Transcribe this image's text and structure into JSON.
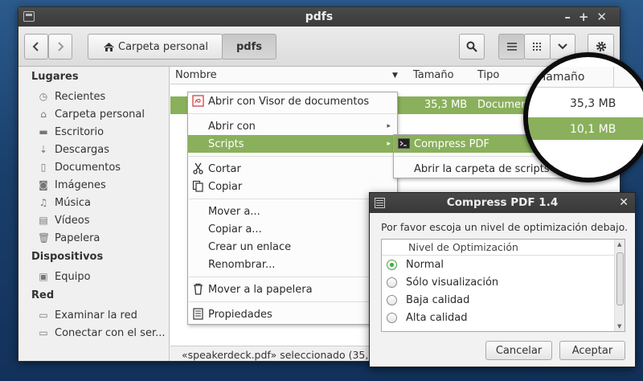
{
  "window": {
    "title": "pdfs"
  },
  "toolbar": {
    "path": [
      "Carpeta personal",
      "pdfs"
    ]
  },
  "sidebar": {
    "sections": [
      {
        "title": "Lugares",
        "items": [
          {
            "label": "Recientes",
            "icon": "clock-icon"
          },
          {
            "label": "Carpeta personal",
            "icon": "home-icon"
          },
          {
            "label": "Escritorio",
            "icon": "desktop-icon"
          },
          {
            "label": "Descargas",
            "icon": "download-icon"
          },
          {
            "label": "Documentos",
            "icon": "document-icon"
          },
          {
            "label": "Imágenes",
            "icon": "camera-icon"
          },
          {
            "label": "Música",
            "icon": "music-icon"
          },
          {
            "label": "Vídeos",
            "icon": "film-icon"
          },
          {
            "label": "Papelera",
            "icon": "trash-icon"
          }
        ]
      },
      {
        "title": "Dispositivos",
        "items": [
          {
            "label": "Equipo",
            "icon": "drive-icon"
          }
        ]
      },
      {
        "title": "Red",
        "items": [
          {
            "label": "Examinar la red",
            "icon": "network-icon"
          },
          {
            "label": "Conectar con el ser...",
            "icon": "server-icon"
          }
        ]
      }
    ]
  },
  "columns": {
    "name": "Nombre",
    "size": "Tamaño",
    "type": "Tipo"
  },
  "files": [
    {
      "size": "35,3 MB",
      "type": "Documen"
    }
  ],
  "status": "«speakerdeck.pdf» seleccionado  (35,",
  "context_menu": {
    "items": {
      "open_with_viewer": "Abrir con Visor de documentos",
      "open_with": "Abrir con",
      "scripts": "Scripts",
      "cut": "Cortar",
      "copy": "Copiar",
      "move_to": "Mover a...",
      "copy_to": "Copiar a...",
      "link": "Crear un enlace",
      "rename": "Renombrar...",
      "trash": "Mover a la papelera",
      "properties": "Propiedades"
    }
  },
  "submenu": {
    "compress": "Compress PDF",
    "open_folder": "Abrir la carpeta de scripts"
  },
  "magnifier": {
    "header": "Tamaño",
    "size1": "35,3 MB",
    "size2": "10,1 MB"
  },
  "dialog": {
    "title": "Compress PDF 1.4",
    "prompt": "Por favor escoja un nivel de optimización debajo.",
    "list_header": "Nivel de Optimización",
    "options": [
      "Normal",
      "Sólo visualización",
      "Baja calidad",
      "Alta calidad"
    ],
    "selected": "Normal",
    "cancel": "Cancelar",
    "accept": "Aceptar"
  }
}
